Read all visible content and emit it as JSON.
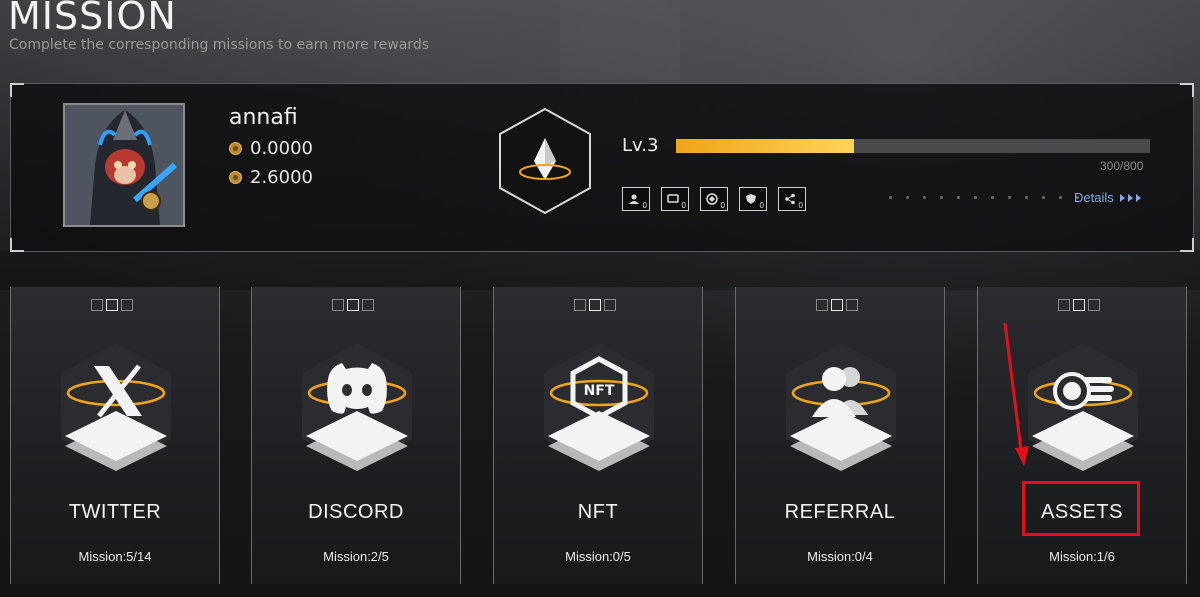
{
  "page": {
    "title": "MISSION",
    "subtitle": "Complete the corresponding missions to earn more rewards"
  },
  "profile": {
    "username": "annafi",
    "balance_1": "0.0000",
    "balance_2": "2.6000",
    "level": "Lv.3",
    "xp_text": "300/800",
    "xp_progress": 0.375,
    "details_label": "Details",
    "badges": [
      {
        "icon": "user-group-icon",
        "count": "0"
      },
      {
        "icon": "message-icon",
        "count": "0"
      },
      {
        "icon": "nft-token-icon",
        "count": "0"
      },
      {
        "icon": "shield-icon",
        "count": "0"
      },
      {
        "icon": "share-icon",
        "count": "0"
      }
    ]
  },
  "cards": [
    {
      "label": "TWITTER",
      "mission": "Mission:5/14",
      "icon": "x-logo-icon"
    },
    {
      "label": "DISCORD",
      "mission": "Mission:2/5",
      "icon": "discord-icon"
    },
    {
      "label": "NFT",
      "mission": "Mission:0/5",
      "icon": "nft-icon"
    },
    {
      "label": "REFERRAL",
      "mission": "Mission:0/4",
      "icon": "users-icon"
    },
    {
      "label": "ASSETS",
      "mission": "Mission:1/6",
      "icon": "coins-icon"
    }
  ],
  "colors": {
    "accent_orange": "#f0a418",
    "highlight_red": "#e3101a",
    "link_blue": "#7ea8e8"
  }
}
